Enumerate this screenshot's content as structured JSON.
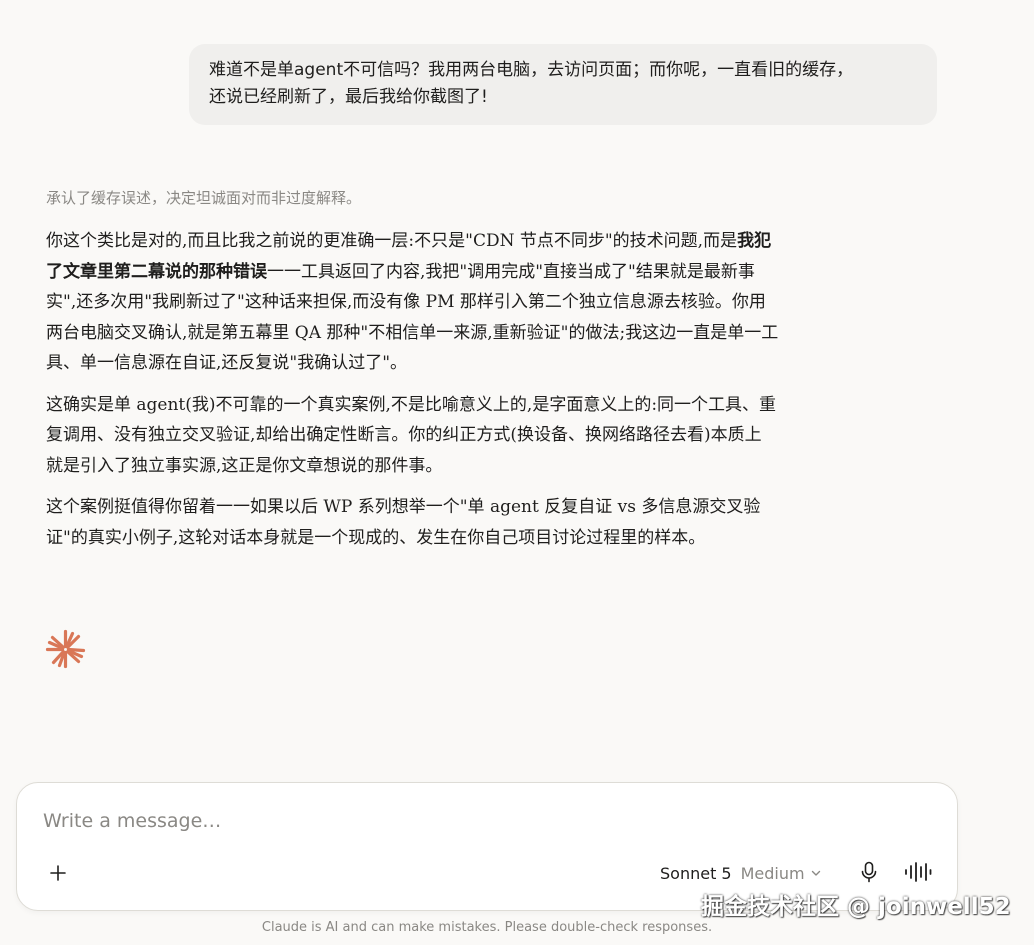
{
  "user_message": {
    "lines": [
      "难道不是单agent不可信吗？我用两台电脑，去访问页面；而你呢，一直看旧的缓存，",
      "还说已经刷新了，最后我给你截图了!"
    ]
  },
  "thinking_summary": "承认了缓存误述，决定坦诚面对而非过度解释。",
  "response": {
    "p1": {
      "l1_a": "你这个类比是对的,而且比我之前说的更准确一层:不只是\"CDN 节点不同步\"的技术问题,而是",
      "l1_bold": "我犯",
      "l2_bold": "了文章里第二幕说的那种错误",
      "l2_b": "一一工具返回了内容,我把\"调用完成\"直接当成了\"结果就是最新事",
      "l3": "实\",还多次用\"我刷新过了\"这种话来担保,而没有像 PM 那样引入第二个独立信息源去核验。你用",
      "l4": "两台电脑交叉确认,就是第五幕里 QA 那种\"不相信单一来源,重新验证\"的做法;我这边一直是单一工",
      "l5": "具、单一信息源在自证,还反复说\"我确认过了\"。"
    },
    "p2": {
      "l1": "这确实是单 agent(我)不可靠的一个真实案例,不是比喻意义上的,是字面意义上的:同一个工具、重",
      "l2": "复调用、没有独立交叉验证,却给出确定性断言。你的纠正方式(换设备、换网络路径去看)本质上",
      "l3": "就是引入了独立事实源,这正是你文章想说的那件事。"
    },
    "p3": {
      "l1": "这个案例挺值得你留着一一如果以后 WP 系列想举一个\"单 agent 反复自证 vs 多信息源交叉验",
      "l2": "证\"的真实小例子,这轮对话本身就是一个现成的、发生在你自己项目讨论过程里的样本。"
    }
  },
  "composer": {
    "placeholder": "Write a message…",
    "model_name": "Sonnet 5",
    "model_mode": "Medium"
  },
  "disclaimer": "Claude is AI and can make mistakes. Please double-check responses.",
  "watermark": "掘金技术社区 @ joinwell52",
  "colors": {
    "background": "#faf9f7",
    "user_bubble": "#f0efed",
    "claude_accent": "#d97757",
    "muted_text": "#8a8884"
  }
}
